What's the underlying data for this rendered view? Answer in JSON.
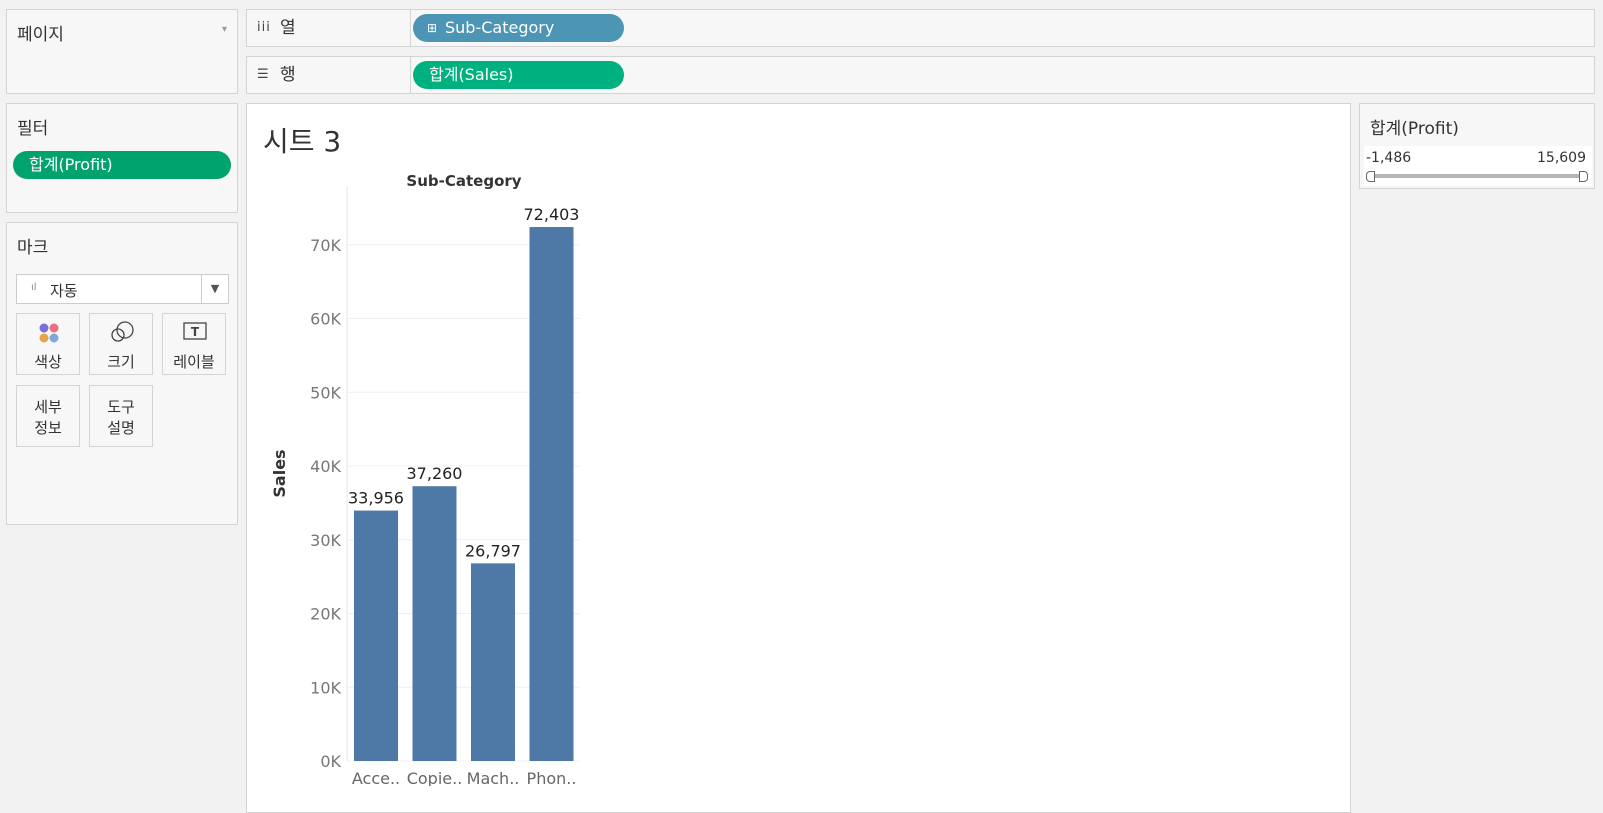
{
  "pages_panel": {
    "title": "페이지"
  },
  "shelves": {
    "columns": {
      "icon": "columns-icon",
      "label": "열",
      "pill": "Sub-Category"
    },
    "rows": {
      "icon": "rows-icon",
      "label": "행",
      "pill": "합계(Sales)"
    }
  },
  "filters": {
    "title": "필터",
    "items": [
      "합계(Profit)"
    ]
  },
  "marks": {
    "title": "마크",
    "type_value": "자동",
    "buttons": [
      {
        "label": "색상",
        "icon": "color-icon"
      },
      {
        "label": "크기",
        "icon": "size-icon"
      },
      {
        "label": "레이블",
        "icon": "label-icon"
      },
      {
        "label": "세부\n정보",
        "label_lines": [
          "세부",
          "정보"
        ],
        "icon": "none"
      },
      {
        "label": "도구\n설명",
        "label_lines": [
          "도구",
          "설명"
        ],
        "icon": "none"
      }
    ]
  },
  "sheet": {
    "title": "시트 3"
  },
  "filter_card": {
    "title": "합계(Profit)",
    "min": "-1,486",
    "max": "15,609"
  },
  "colors": {
    "bar": "#4e79a7",
    "pill_blue": "#4d95b5",
    "pill_green": "#00b180"
  },
  "chart_data": {
    "type": "bar",
    "title": "Sub-Category",
    "xlabel": "",
    "ylabel": "Sales",
    "categories": [
      "Acce..",
      "Copie..",
      "Mach..",
      "Phon.."
    ],
    "values": [
      33956,
      37260,
      26797,
      72403
    ],
    "value_labels": [
      "33,956",
      "37,260",
      "26,797",
      "72,403"
    ],
    "yticks": [
      0,
      10000,
      20000,
      30000,
      40000,
      50000,
      60000,
      70000
    ],
    "ytick_labels": [
      "0K",
      "10K",
      "20K",
      "30K",
      "40K",
      "50K",
      "60K",
      "70K"
    ],
    "ylim": [
      0,
      80000
    ],
    "grid": true
  }
}
